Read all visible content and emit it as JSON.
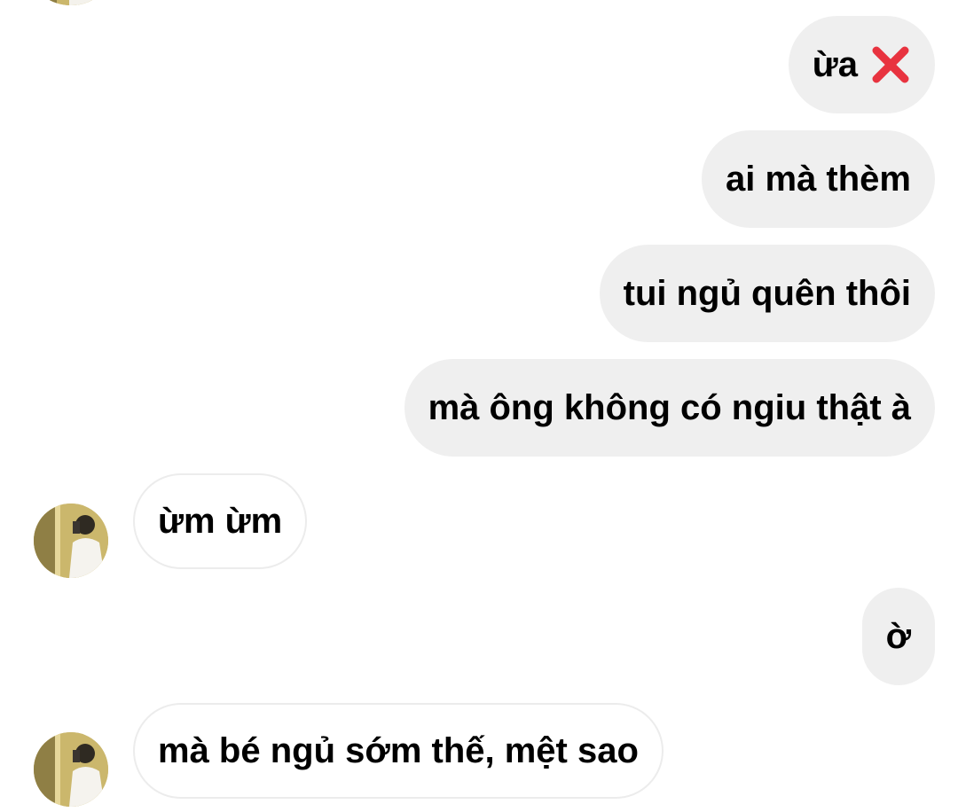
{
  "messages": [
    {
      "side": "out",
      "text": "ừa",
      "icon": "cross-mark-icon"
    },
    {
      "side": "out",
      "text": "ai mà thèm"
    },
    {
      "side": "out",
      "text": "tui ngủ quên thôi"
    },
    {
      "side": "out",
      "text": "mà ông không có ngiu thật à"
    },
    {
      "side": "in",
      "text": "ừm ừm"
    },
    {
      "side": "out",
      "text": "ờ"
    },
    {
      "side": "in",
      "text": "mà bé ngủ sớm thế, mệt sao"
    }
  ],
  "colors": {
    "outgoing_bubble": "#efefef",
    "incoming_border": "#ececec",
    "cross_mark": "#e8333f",
    "avatar_background": "#c9b46a"
  }
}
